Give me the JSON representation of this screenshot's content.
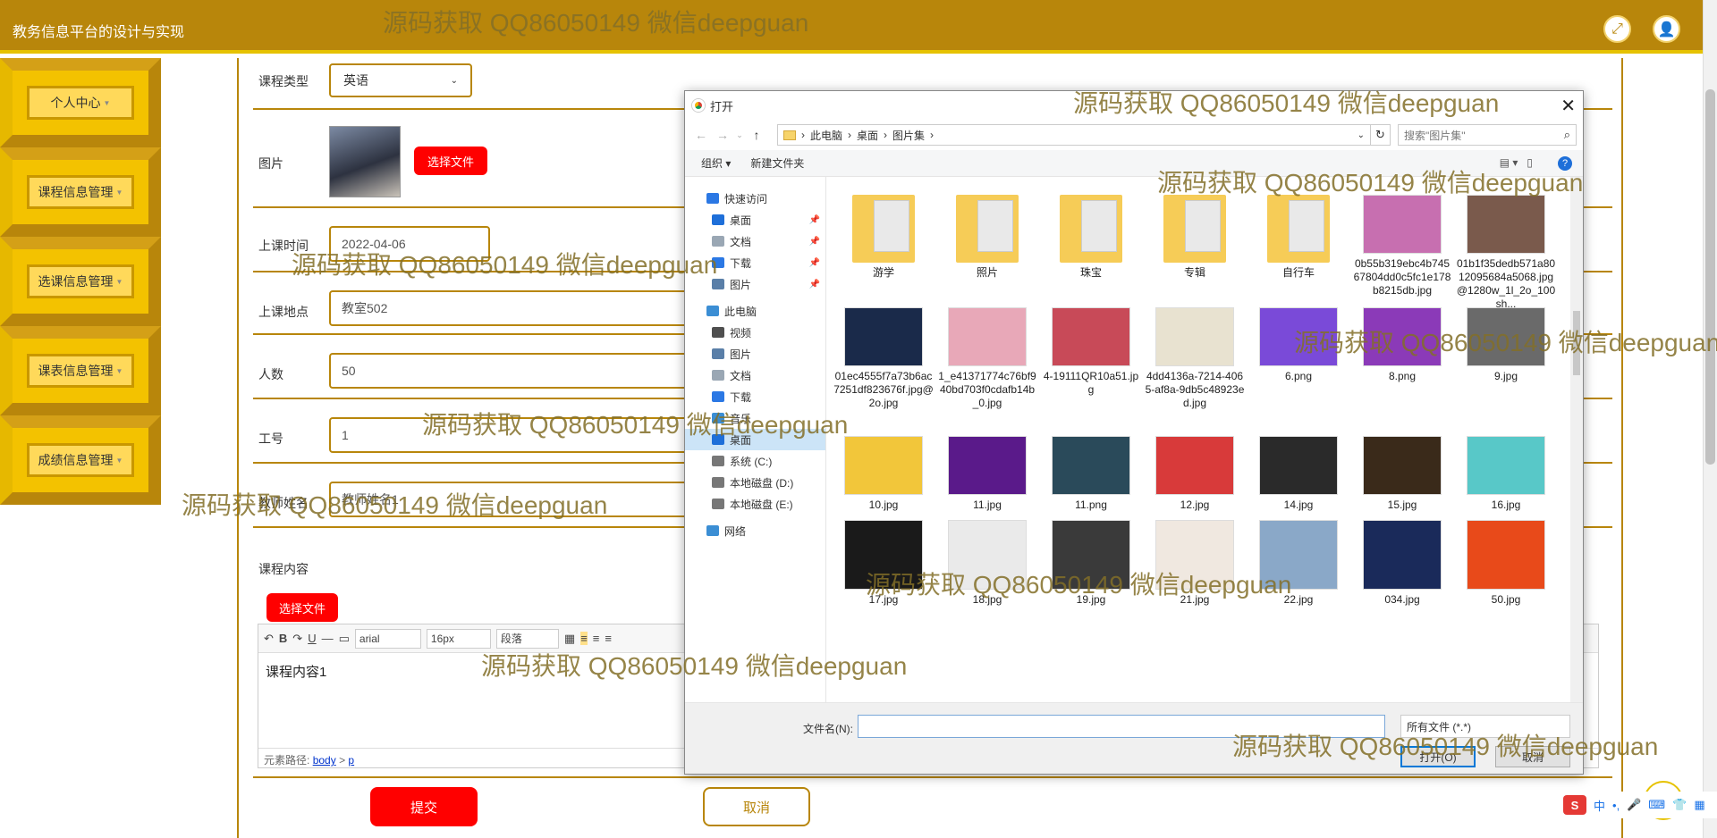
{
  "header": {
    "title": "教务信息平台的设计与实现"
  },
  "sidebar": {
    "items": [
      {
        "label": "个人中心"
      },
      {
        "label": "课程信息管理"
      },
      {
        "label": "选课信息管理"
      },
      {
        "label": "课表信息管理"
      },
      {
        "label": "成绩信息管理"
      }
    ]
  },
  "form": {
    "course_type_label": "课程类型",
    "course_type_value": "英语",
    "image_label": "图片",
    "choose_file": "选择文件",
    "time_label": "上课时间",
    "time_value": "2022-04-06",
    "place_label": "上课地点",
    "place_value": "教室502",
    "count_label": "人数",
    "count_value": "50",
    "id_label": "工号",
    "id_value": "1",
    "teacher_label": "教师姓名",
    "teacher_value": "教师姓名1",
    "content_label": "课程内容",
    "content_choose_file": "选择文件",
    "editor_font": "arial",
    "editor_size": "16px",
    "editor_para": "段落",
    "editor_text": "课程内容1",
    "editor_path_label": "元素路径:",
    "editor_path_body": "body",
    "editor_path_sep": ">",
    "editor_path_p": "p",
    "submit": "提交",
    "cancel": "取消"
  },
  "dialog": {
    "title": "打开",
    "path": [
      "此电脑",
      "桌面",
      "图片集"
    ],
    "search_placeholder": "搜索\"图片集\"",
    "organize": "组织 ▾",
    "new_folder": "新建文件夹",
    "nav": [
      {
        "label": "快速访问",
        "lvl": 1,
        "color": "#2b78e4"
      },
      {
        "label": "桌面",
        "lvl": 2,
        "color": "#1e6fd9",
        "pin": true
      },
      {
        "label": "文档",
        "lvl": 2,
        "color": "#9aa7b4",
        "pin": true
      },
      {
        "label": "下载",
        "lvl": 2,
        "color": "#2b78e4",
        "pin": true
      },
      {
        "label": "图片",
        "lvl": 2,
        "color": "#5a7fa8",
        "pin": true
      },
      {
        "label": "此电脑",
        "lvl": 1,
        "color": "#3b8ed4"
      },
      {
        "label": "视频",
        "lvl": 2,
        "color": "#4f4f4f"
      },
      {
        "label": "图片",
        "lvl": 2,
        "color": "#5a7fa8"
      },
      {
        "label": "文档",
        "lvl": 2,
        "color": "#9aa7b4"
      },
      {
        "label": "下载",
        "lvl": 2,
        "color": "#2b78e4"
      },
      {
        "label": "音乐",
        "lvl": 2,
        "color": "#3b8ed4"
      },
      {
        "label": "桌面",
        "lvl": 2,
        "color": "#1e6fd9",
        "selected": true
      },
      {
        "label": "系统 (C:)",
        "lvl": 2,
        "color": "#777"
      },
      {
        "label": "本地磁盘 (D:)",
        "lvl": 2,
        "color": "#777"
      },
      {
        "label": "本地磁盘 (E:)",
        "lvl": 2,
        "color": "#777"
      },
      {
        "label": "网络",
        "lvl": 1,
        "color": "#3b8ed4"
      }
    ],
    "files": [
      {
        "name": "游学",
        "kind": "folder"
      },
      {
        "name": "照片",
        "kind": "folder"
      },
      {
        "name": "珠宝",
        "kind": "folder"
      },
      {
        "name": "专辑",
        "kind": "folder"
      },
      {
        "name": "自行车",
        "kind": "folder"
      },
      {
        "name": "0b55b319ebc4b74567804dd0c5fc1e178b8215db.jpg",
        "kind": "img",
        "color": "#c76fb0"
      },
      {
        "name": "01b1f35dedb571a8012095684a5068.jpg@1280w_1l_2o_100sh...",
        "kind": "img",
        "color": "#7a5a4c"
      },
      {
        "name": "01ec4555f7a73b6ac7251df823676f.jpg@2o.jpg",
        "kind": "img",
        "color": "#1a2a4a"
      },
      {
        "name": "1_e41371774c76bf940bd703f0cdafb14b_0.jpg",
        "kind": "img",
        "color": "#e8a8b8"
      },
      {
        "name": "4-19111QR10a51.jpg",
        "kind": "img",
        "color": "#c84a58"
      },
      {
        "name": "4dd4136a-7214-4065-af8a-9db5c48923ed.jpg",
        "kind": "img",
        "color": "#e8e2d0"
      },
      {
        "name": "6.png",
        "kind": "img",
        "color": "#7a4ad8"
      },
      {
        "name": "8.png",
        "kind": "img",
        "color": "#8b3ab8"
      },
      {
        "name": "9.jpg",
        "kind": "img",
        "color": "#6a6a6a"
      },
      {
        "name": "10.jpg",
        "kind": "img",
        "color": "#f2c63a"
      },
      {
        "name": "11.jpg",
        "kind": "img",
        "color": "#5a1a8a"
      },
      {
        "name": "11.png",
        "kind": "img",
        "color": "#2a4a5a"
      },
      {
        "name": "12.jpg",
        "kind": "img",
        "color": "#d83a3a"
      },
      {
        "name": "14.jpg",
        "kind": "img",
        "color": "#2a2a2a"
      },
      {
        "name": "15.jpg",
        "kind": "img",
        "color": "#3a2a1a"
      },
      {
        "name": "16.jpg",
        "kind": "img",
        "color": "#58c8c8"
      },
      {
        "name": "17.jpg",
        "kind": "img",
        "color": "#1a1a1a"
      },
      {
        "name": "18.jpg",
        "kind": "img",
        "color": "#eaeaea"
      },
      {
        "name": "19.jpg",
        "kind": "img",
        "color": "#3a3a3a"
      },
      {
        "name": "21.jpg",
        "kind": "img",
        "color": "#f0e8e0"
      },
      {
        "name": "22.jpg",
        "kind": "img",
        "color": "#8aa8c8"
      },
      {
        "name": "034.jpg",
        "kind": "img",
        "color": "#1a2a5a"
      },
      {
        "name": "50.jpg",
        "kind": "img",
        "color": "#e84a1a"
      }
    ],
    "filename_label": "文件名(N):",
    "filetype": "所有文件 (*.*)",
    "open": "打开(O)",
    "cancel": "取消"
  },
  "watermark": "源码获取 QQ86050149 微信deepguan",
  "ime": {
    "lang": "中",
    "punct": "•,"
  }
}
